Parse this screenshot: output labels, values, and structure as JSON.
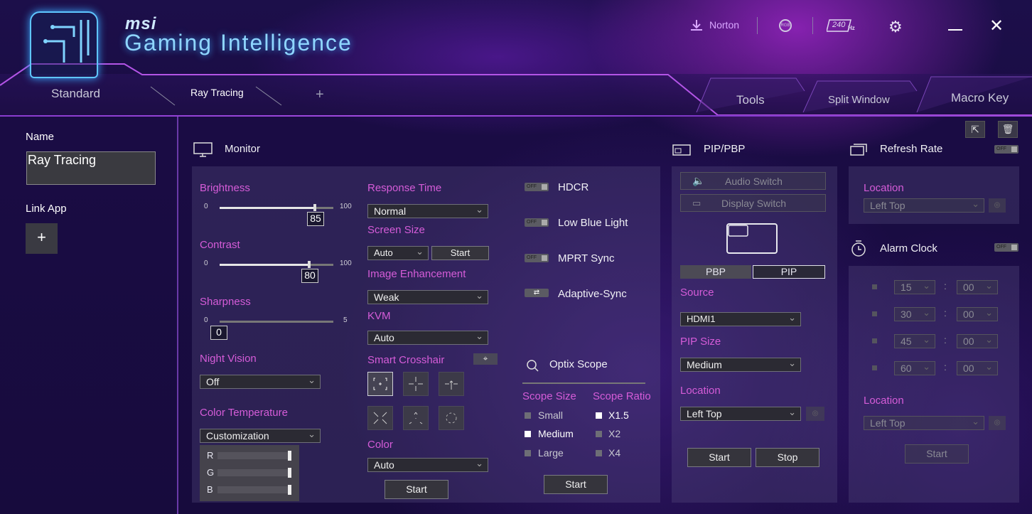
{
  "header": {
    "brand": "msi",
    "app_title": "Gaming Intelligence",
    "norton_label": "Norton",
    "rgb_label": "RGB",
    "hz_label": "240",
    "hz_unit": "Hz"
  },
  "tabs": {
    "standard": "Standard",
    "ray_tracing": "Ray Tracing",
    "add": "+",
    "tools": "Tools",
    "split_window": "Split Window",
    "macro_key": "Macro Key"
  },
  "sidebar": {
    "name_label": "Name",
    "name_value": "Ray Tracing",
    "link_app_label": "Link App",
    "add_label": "+"
  },
  "monitor": {
    "title": "Monitor",
    "brightness": {
      "label": "Brightness",
      "min": "0",
      "max": "100",
      "value": "85",
      "fraction": 0.85
    },
    "contrast": {
      "label": "Contrast",
      "min": "0",
      "max": "100",
      "value": "80",
      "fraction": 0.8
    },
    "sharpness": {
      "label": "Sharpness",
      "min": "0",
      "max": "5",
      "value": "0",
      "fraction": 0
    },
    "night_vision": {
      "label": "Night Vision",
      "value": "Off"
    },
    "color_temperature": {
      "label": "Color Temperature",
      "value": "Customization",
      "r": "R",
      "g": "G",
      "b": "B"
    },
    "response_time": {
      "label": "Response Time",
      "value": "Normal"
    },
    "screen_size": {
      "label": "Screen Size",
      "value": "Auto",
      "start": "Start"
    },
    "image_enhancement": {
      "label": "Image Enhancement",
      "value": "Weak"
    },
    "kvm": {
      "label": "KVM",
      "value": "Auto"
    },
    "smart_crosshair": {
      "label": "Smart Crosshair"
    },
    "color": {
      "label": "Color",
      "value": "Auto",
      "start": "Start"
    },
    "toggles": {
      "off_text": "OFF",
      "hdcr": "HDCR",
      "low_blue_light": "Low Blue Light",
      "mprt_sync": "MPRT Sync",
      "adaptive_sync": "Adaptive-Sync"
    },
    "optix_scope": {
      "title": "Optix Scope",
      "scope_size_label": "Scope Size",
      "scope_ratio_label": "Scope Ratio",
      "sizes": [
        "Small",
        "Medium",
        "Large"
      ],
      "ratios": [
        "X1.5",
        "X2",
        "X4"
      ],
      "start": "Start"
    }
  },
  "pip": {
    "title": "PIP/PBP",
    "audio_switch": "Audio Switch",
    "display_switch": "Display Switch",
    "pbp": "PBP",
    "pip": "PIP",
    "source_label": "Source",
    "source_value": "HDMI1",
    "size_label": "PIP Size",
    "size_value": "Medium",
    "location_label": "Location",
    "location_value": "Left Top",
    "start": "Start",
    "stop": "Stop"
  },
  "refresh_rate": {
    "title": "Refresh Rate",
    "location_label": "Location",
    "location_value": "Left Top"
  },
  "alarm_clock": {
    "title": "Alarm Clock",
    "rows": [
      {
        "min": "15",
        "sec": "00"
      },
      {
        "min": "30",
        "sec": "00"
      },
      {
        "min": "45",
        "sec": "00"
      },
      {
        "min": "60",
        "sec": "00"
      }
    ],
    "colon": ":",
    "location_label": "Location",
    "location_value": "Left Top",
    "start": "Start"
  }
}
